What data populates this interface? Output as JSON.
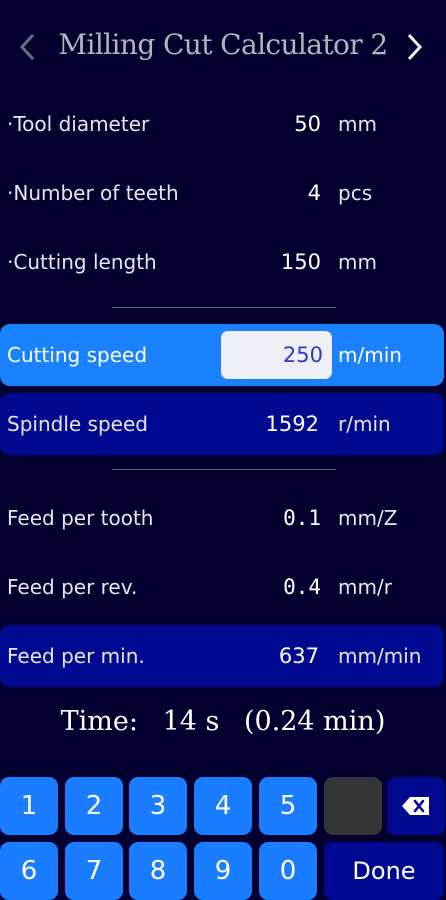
{
  "header": {
    "title": "Milling Cut Calculator 2",
    "prev_icon": "chevron-left-icon",
    "next_icon": "chevron-right-icon"
  },
  "inputs": [
    {
      "label": "·Tool diameter",
      "value": "50",
      "unit": "mm"
    },
    {
      "label": "·Number of teeth",
      "value": "4",
      "unit": "pcs"
    },
    {
      "label": "·Cutting length",
      "value": "150",
      "unit": "mm"
    }
  ],
  "speed": {
    "cutting": {
      "label": "Cutting speed",
      "value": "250",
      "unit": "m/min"
    },
    "spindle": {
      "label": "Spindle speed",
      "value": "1592",
      "unit": "r/min"
    }
  },
  "feed": {
    "per_tooth": {
      "label": "Feed per tooth",
      "value": "0.1",
      "unit": "mm/Z"
    },
    "per_rev": {
      "label": "Feed per rev.",
      "value": "0.4",
      "unit": "mm/r"
    },
    "per_min": {
      "label": "Feed per min.",
      "value": "637",
      "unit": "mm/min"
    }
  },
  "time": {
    "label": "Time:",
    "seconds": "14 s",
    "minutes": "(0.24 min)"
  },
  "keypad": {
    "row1": [
      "1",
      "2",
      "3",
      "4",
      "5"
    ],
    "row2": [
      "6",
      "7",
      "8",
      "9",
      "0"
    ],
    "backspace_icon": "backspace-icon",
    "done_label": "Done"
  },
  "colors": {
    "background": "#03002f",
    "active_row": "#1a82ff",
    "result_row": "#00098f",
    "key": "#1a7dff"
  }
}
